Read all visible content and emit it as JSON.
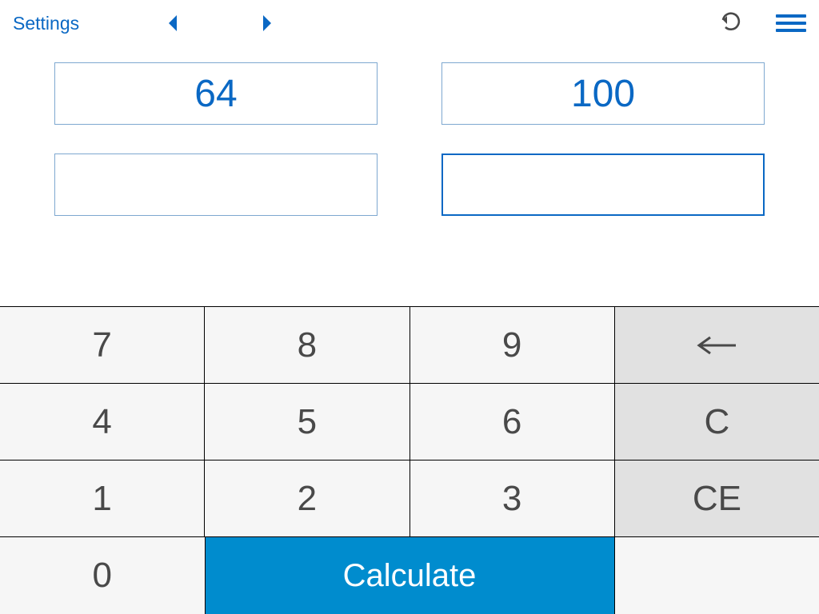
{
  "header": {
    "settings_label": "Settings"
  },
  "fields": {
    "top_left": "64",
    "top_right": "100",
    "bottom_left": "",
    "bottom_right": ""
  },
  "keypad": {
    "k7": "7",
    "k8": "8",
    "k9": "9",
    "k4": "4",
    "k5": "5",
    "k6": "6",
    "k1": "1",
    "k2": "2",
    "k3": "3",
    "k0": "0",
    "clear": "C",
    "clear_entry": "CE",
    "calculate": "Calculate"
  },
  "colors": {
    "accent": "#0a68c4",
    "calc_bg": "#008cce",
    "key_bg": "#f6f6f6",
    "fn_bg": "#e1e1e1",
    "text_gray": "#494949"
  }
}
